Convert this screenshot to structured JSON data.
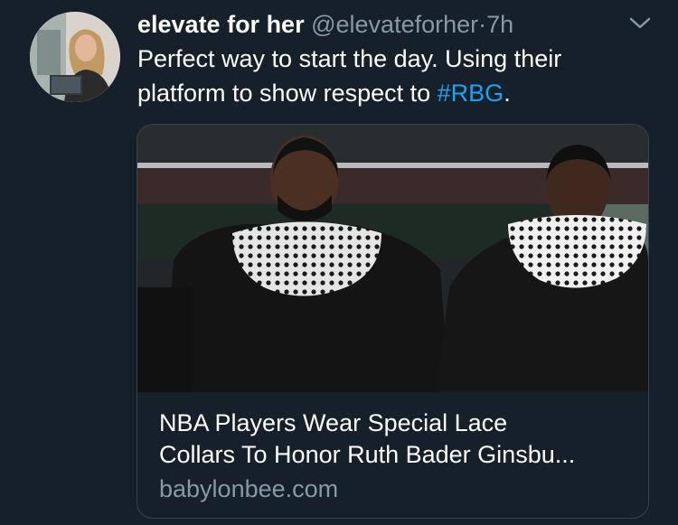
{
  "tweet": {
    "author_name": "elevate for her",
    "handle": "@elevateforher",
    "separator": "·",
    "time": "7h",
    "text_before": "Perfect way to start the day. Using their platform to show respect to ",
    "hashtag": "#RBG",
    "text_after": ".",
    "menu_icon": "chevron-down-icon"
  },
  "card": {
    "title_line1": "NBA Players Wear Special Lace",
    "title_line2": "Collars To Honor Ruth Bader Ginsbu...",
    "domain": "babylonbee.com"
  },
  "colors": {
    "background": "#15202b",
    "text": "#ffffff",
    "secondary": "#8899a6",
    "link": "#1da1f2",
    "border": "#38444d"
  }
}
